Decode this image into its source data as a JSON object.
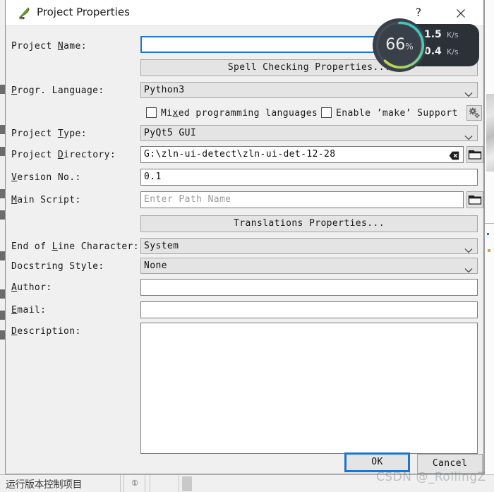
{
  "window": {
    "title": "Project Properties",
    "icon": "eric-ide-icon",
    "help_label": "?",
    "close_label": "✕"
  },
  "form": {
    "project_name": {
      "label_pre": "Project ",
      "label_key": "N",
      "label_post": "ame:",
      "value": "",
      "placeholder": ""
    },
    "spell_checking_button": "Spell Checking Properties...",
    "progr_language": {
      "label_pre": "",
      "label_key": "P",
      "label_post": "rogr. Language:",
      "value": "Python3"
    },
    "mixed_languages": {
      "label_pre": "Mi",
      "label_key": "x",
      "label_post": "ed programming languages",
      "checked": false
    },
    "enable_make": {
      "label_pre": "Enable ’make’ Support",
      "label_key": "",
      "label_post": "",
      "checked": false
    },
    "make_settings_button": "gear-icon",
    "project_type": {
      "label_pre": "Project ",
      "label_key": "T",
      "label_post": "ype:",
      "value": "PyQt5 GUI"
    },
    "project_directory": {
      "label_pre": "Project ",
      "label_key": "D",
      "label_post": "irectory:",
      "value": "G:\\zln-ui-detect\\zln-ui-det-12-28",
      "clear_icon": "clear-icon",
      "browse_icon": "folder-icon"
    },
    "version_no": {
      "label_pre": "",
      "label_key": "V",
      "label_post": "ersion No.:",
      "value": "0.1"
    },
    "main_script": {
      "label_pre": "",
      "label_key": "M",
      "label_post": "ain Script:",
      "value": "",
      "placeholder": "Enter Path Name",
      "browse_icon": "folder-icon"
    },
    "translations_button": "Translations Properties...",
    "eol_character": {
      "label_pre": "End of ",
      "label_key": "L",
      "label_post": "ine Character:",
      "value": "System"
    },
    "docstring_style": {
      "label_pre": "Docstring Style:",
      "label_key": "",
      "label_post": "",
      "value": "None"
    },
    "author": {
      "label_pre": "",
      "label_key": "A",
      "label_post": "uthor:",
      "value": ""
    },
    "email": {
      "label_pre": "",
      "label_key": "E",
      "label_post": "mail:",
      "value": ""
    },
    "description": {
      "label_pre": "",
      "label_key": "D",
      "label_post": "escription:",
      "value": ""
    }
  },
  "buttons": {
    "ok": "OK",
    "cancel": "Cancel"
  },
  "net_widget": {
    "percent": "66",
    "percent_sign": "%",
    "upload_value": "1.5",
    "upload_unit": "K/s",
    "download_value": "0.4",
    "download_unit": "K/s",
    "ring_start_color": "#35c4c4",
    "ring_end_color": "#cfd64a"
  },
  "background": {
    "bottom_text": "运行版本控制项目",
    "bottom_number": "①"
  },
  "watermark": "CSDN @_RollingZ"
}
